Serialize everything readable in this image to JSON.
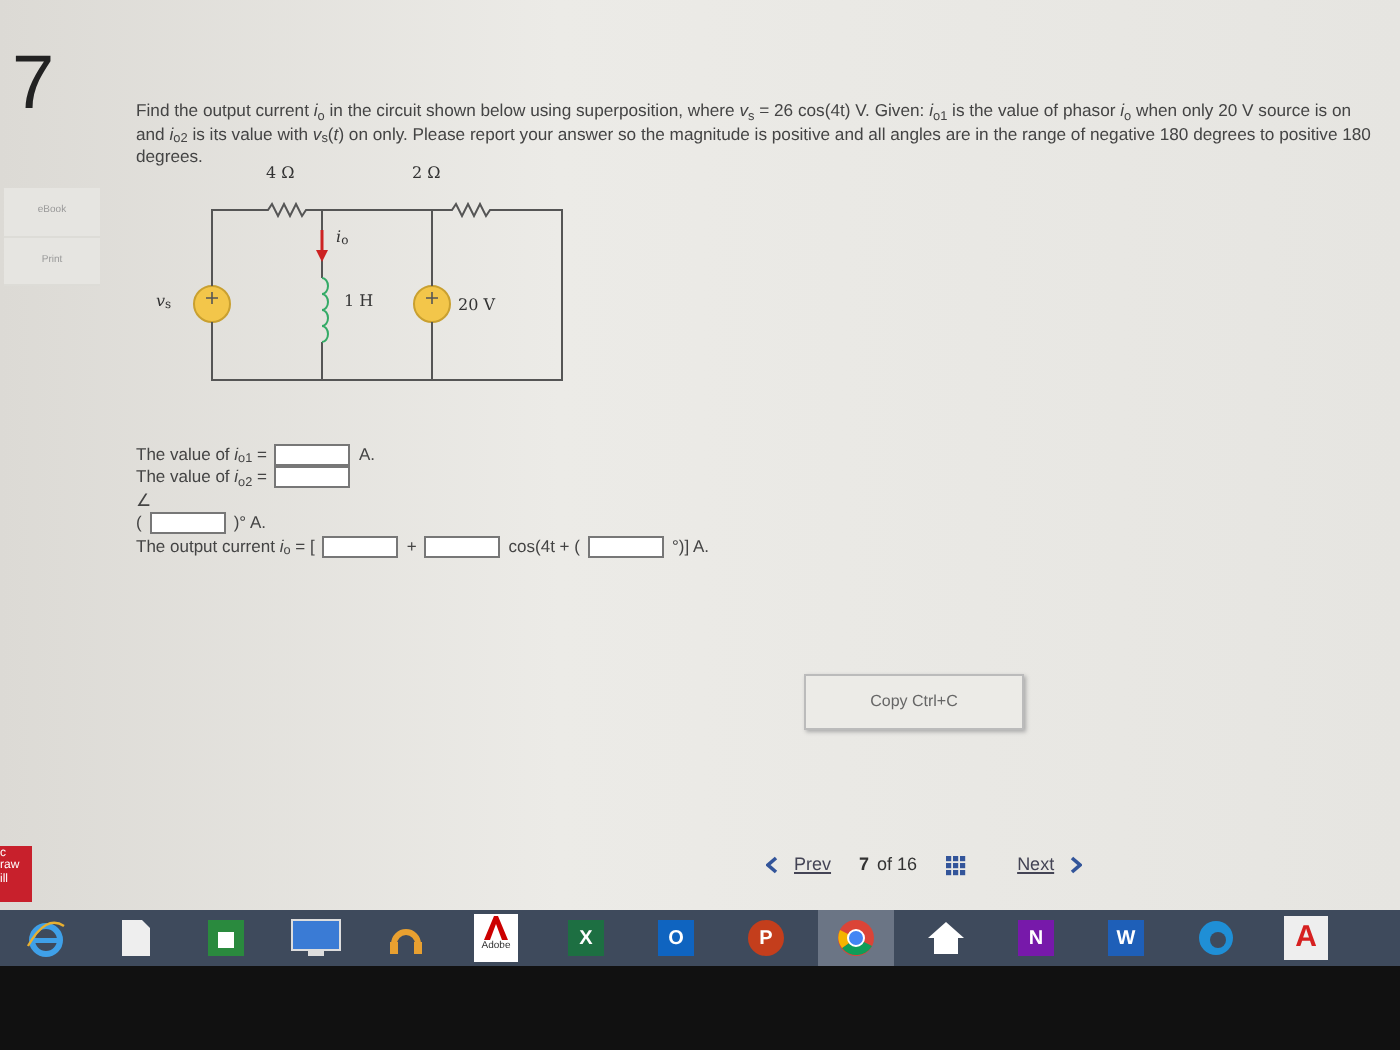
{
  "question_number": "7",
  "side_buttons": [
    "eBook",
    "Print"
  ],
  "problem": "Find the output current *i*$_{o}$ in the circuit shown below using superposition, where *v*$_{s}$ = 26 cos(4t) V. Given: *i*$_{o1}$ is the value of phasor *i*$_{o}$ when only 20 V source is on and *i*$_{o2}$ is its value with *v*$_{s}$(*t*) on only. Please report your answer so the magnitude is positive and all angles are in the range of negative 180 degrees to positive 180 degrees.",
  "circuit": {
    "r1": "4 Ω",
    "r2": "2 Ω",
    "source_left": "*v*$_{s}$",
    "current": "*i*$_{o}$",
    "inductor": "1 H",
    "source_right": "20 V"
  },
  "answer_lines": [
    [
      {
        "kind": "text",
        "text": "The value of *i*$_{o1}$ ="
      },
      {
        "kind": "field"
      },
      {
        "kind": "text",
        "text": "A."
      }
    ],
    [
      {
        "kind": "text",
        "text": "The value of *i*$_{o2}$ ="
      },
      {
        "kind": "field"
      }
    ],
    [
      {
        "kind": "text",
        "text": "∠"
      }
    ],
    [
      {
        "kind": "text",
        "text": "("
      },
      {
        "kind": "field"
      },
      {
        "kind": "text",
        "text": ")° A."
      }
    ],
    [
      {
        "kind": "text",
        "text": "The output current *i*$_{o}$ = ["
      },
      {
        "kind": "field"
      },
      {
        "kind": "text",
        "text": "+"
      },
      {
        "kind": "field"
      },
      {
        "kind": "text",
        "text": "cos(4t + ("
      },
      {
        "kind": "field"
      },
      {
        "kind": "text",
        "text": "°)] A."
      }
    ]
  ],
  "copy_button": "Copy  Ctrl+C",
  "pager": {
    "prev": "Prev",
    "current": "7",
    "total": "of 16",
    "next": "Next"
  },
  "logo_lines": [
    "c",
    "raw",
    "ill"
  ],
  "taskbar": [
    {
      "kind": "ie"
    },
    {
      "kind": "file"
    },
    {
      "kind": "store"
    },
    {
      "kind": "monitor"
    },
    {
      "kind": "headphones"
    },
    {
      "kind": "adobe",
      "label": "Adobe"
    },
    {
      "kind": "tile",
      "label": "X",
      "color": "#1d6f42"
    },
    {
      "kind": "tile",
      "label": "O",
      "color": "#0f64c0"
    },
    {
      "kind": "circle",
      "label": "P",
      "color": "#c43e1c"
    },
    {
      "kind": "chrome"
    },
    {
      "kind": "home"
    },
    {
      "kind": "tile",
      "label": "N",
      "color": "#7719aa"
    },
    {
      "kind": "tile",
      "label": "W",
      "color": "#1e5fb8"
    },
    {
      "kind": "edge"
    },
    {
      "kind": "letter",
      "label": "A",
      "color": "#d62020"
    }
  ]
}
